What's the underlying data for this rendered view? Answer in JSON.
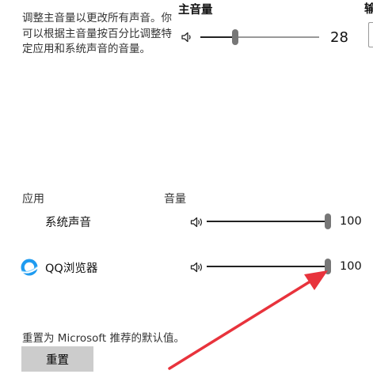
{
  "description": "调整主音量以更改所有声音。你可以根据主音量按百分比调整特定应用和系统声音的音量。",
  "master": {
    "title": "主音量",
    "value": 28,
    "value_label": "28"
  },
  "cut_off_title_char": "输",
  "columns": {
    "app": "应用",
    "volume": "音量"
  },
  "apps": [
    {
      "name": "系统声音",
      "value": 100,
      "value_label": "100",
      "icon": "none"
    },
    {
      "name": "QQ浏览器",
      "value": 100,
      "value_label": "100",
      "icon": "qq-browser-icon"
    }
  ],
  "reset": {
    "description": "重置为 Microsoft 推荐的默认值。",
    "button_label": "重置"
  },
  "colors": {
    "track_fill": "#222222",
    "track_empty": "#999999",
    "thumb": "#777777",
    "button_bg": "#cccccc",
    "annotation_arrow": "#e8333c",
    "qq_icon_blue": "#1e9bf0"
  }
}
